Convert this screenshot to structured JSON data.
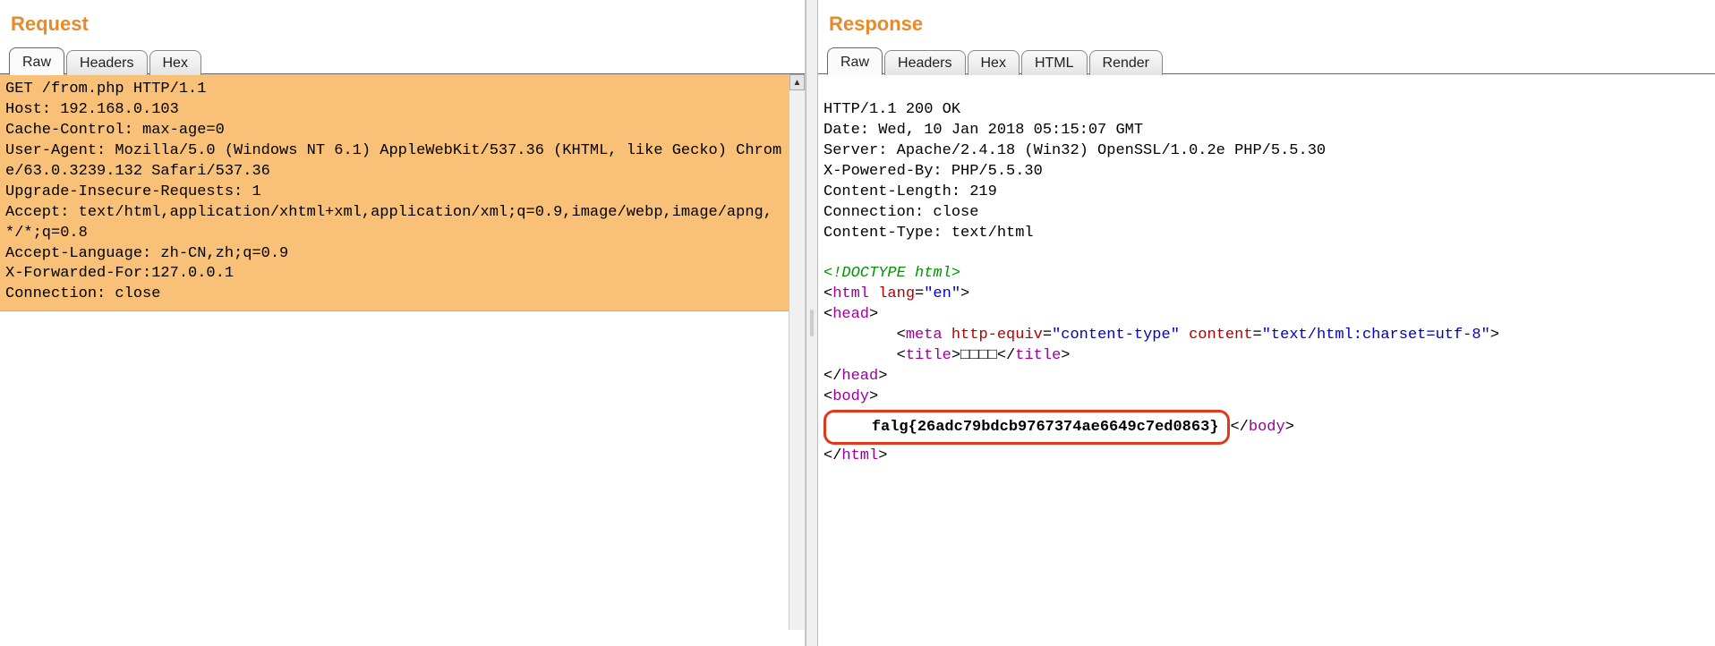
{
  "request": {
    "title": "Request",
    "tabs": [
      "Raw",
      "Headers",
      "Hex"
    ],
    "active_tab": "Raw",
    "raw": "GET /from.php HTTP/1.1\nHost: 192.168.0.103\nCache-Control: max-age=0\nUser-Agent: Mozilla/5.0 (Windows NT 6.1) AppleWebKit/537.36 (KHTML, like Gecko) Chrome/63.0.3239.132 Safari/537.36\nUpgrade-Insecure-Requests: 1\nAccept: text/html,application/xhtml+xml,application/xml;q=0.9,image/webp,image/apng,*/*;q=0.8\nAccept-Language: zh-CN,zh;q=0.9\nX-Forwarded-For:127.0.0.1\nConnection: close\n"
  },
  "response": {
    "title": "Response",
    "tabs": [
      "Raw",
      "Headers",
      "Hex",
      "HTML",
      "Render"
    ],
    "active_tab": "Raw",
    "headers_text": "HTTP/1.1 200 OK\nDate: Wed, 10 Jan 2018 05:15:07 GMT\nServer: Apache/2.4.18 (Win32) OpenSSL/1.0.2e PHP/5.5.30\nX-Powered-By: PHP/5.5.30\nContent-Length: 219\nConnection: close\nContent-Type: text/html\n",
    "body": {
      "doctype": "<!DOCTYPE html>",
      "html_open": "html",
      "html_lang_attr": "lang",
      "html_lang_val": "\"en\"",
      "head_open": "head",
      "meta_tag": "meta",
      "meta_he_attr": "http-equiv",
      "meta_he_val": "\"content-type\"",
      "meta_c_attr": "content",
      "meta_c_val": "\"text/html:charset=utf-8\"",
      "title_tag": "title",
      "title_text": "□□□□",
      "head_close": "head",
      "body_open": "body",
      "flag_text": "falg{26adc79bdcb9767374ae6649c7ed0863}",
      "body_close": "body",
      "html_close": "html"
    }
  }
}
